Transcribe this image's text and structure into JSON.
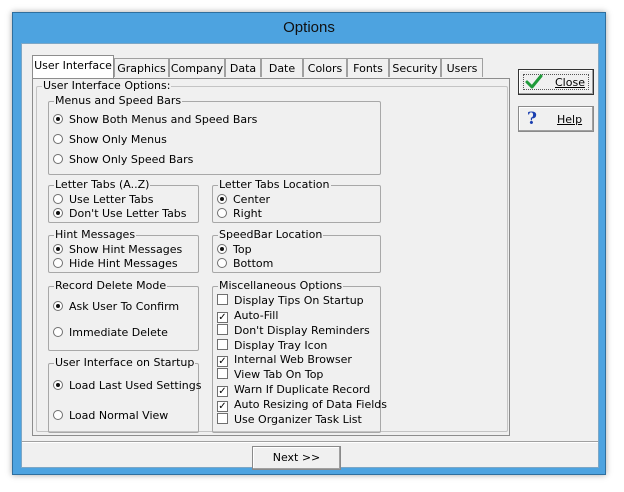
{
  "window": {
    "title": "Options"
  },
  "tabs": [
    {
      "label": "User Interface"
    },
    {
      "label": "Graphics"
    },
    {
      "label": "Company"
    },
    {
      "label": "Data"
    },
    {
      "label": "Date"
    },
    {
      "label": "Colors"
    },
    {
      "label": "Fonts"
    },
    {
      "label": "Security"
    },
    {
      "label": "Users"
    }
  ],
  "panel": {
    "title": "User Interface Options:"
  },
  "menus": {
    "title": "Menus and Speed Bars",
    "options": [
      "Show Both Menus and Speed Bars",
      "Show Only Menus",
      "Show Only Speed Bars"
    ],
    "selected": 0
  },
  "letter_tabs": {
    "title": "Letter Tabs (A..Z)",
    "options": [
      "Use Letter Tabs",
      "Don't Use Letter Tabs"
    ],
    "selected": 1
  },
  "letter_tabs_location": {
    "title": "Letter Tabs Location",
    "options": [
      "Center",
      "Right"
    ],
    "selected": 0
  },
  "hint": {
    "title": "Hint Messages",
    "options": [
      "Show Hint Messages",
      "Hide Hint Messages"
    ],
    "selected": 0
  },
  "speedbar_location": {
    "title": "SpeedBar Location",
    "options": [
      "Top",
      "Bottom"
    ],
    "selected": 0
  },
  "record_delete": {
    "title": "Record Delete Mode",
    "options": [
      "Ask User To Confirm",
      "Immediate Delete"
    ],
    "selected": 0
  },
  "startup": {
    "title": "User Interface on Startup",
    "options": [
      "Load Last Used Settings",
      "Load Normal View"
    ],
    "selected": 0
  },
  "misc": {
    "title": "Miscellaneous Options",
    "items": [
      {
        "label": "Display Tips On Startup",
        "checked": false
      },
      {
        "label": "Auto-Fill",
        "checked": true
      },
      {
        "label": "Don't Display Reminders",
        "checked": false
      },
      {
        "label": "Display Tray Icon",
        "checked": false
      },
      {
        "label": "Internal Web Browser",
        "checked": true
      },
      {
        "label": "View Tab On Top",
        "checked": false
      },
      {
        "label": "Warn If Duplicate Record",
        "checked": true
      },
      {
        "label": "Auto Resizing of Data Fields",
        "checked": true
      },
      {
        "label": "Use Organizer Task List",
        "checked": false
      }
    ]
  },
  "buttons": {
    "close": "Close",
    "help": "Help",
    "next": "Next >>"
  },
  "colors": {
    "titlebar": "#4da3e0",
    "client": "#f0f0f0",
    "check_green": "#1f9a3a",
    "help_blue": "#1a3fb0"
  }
}
